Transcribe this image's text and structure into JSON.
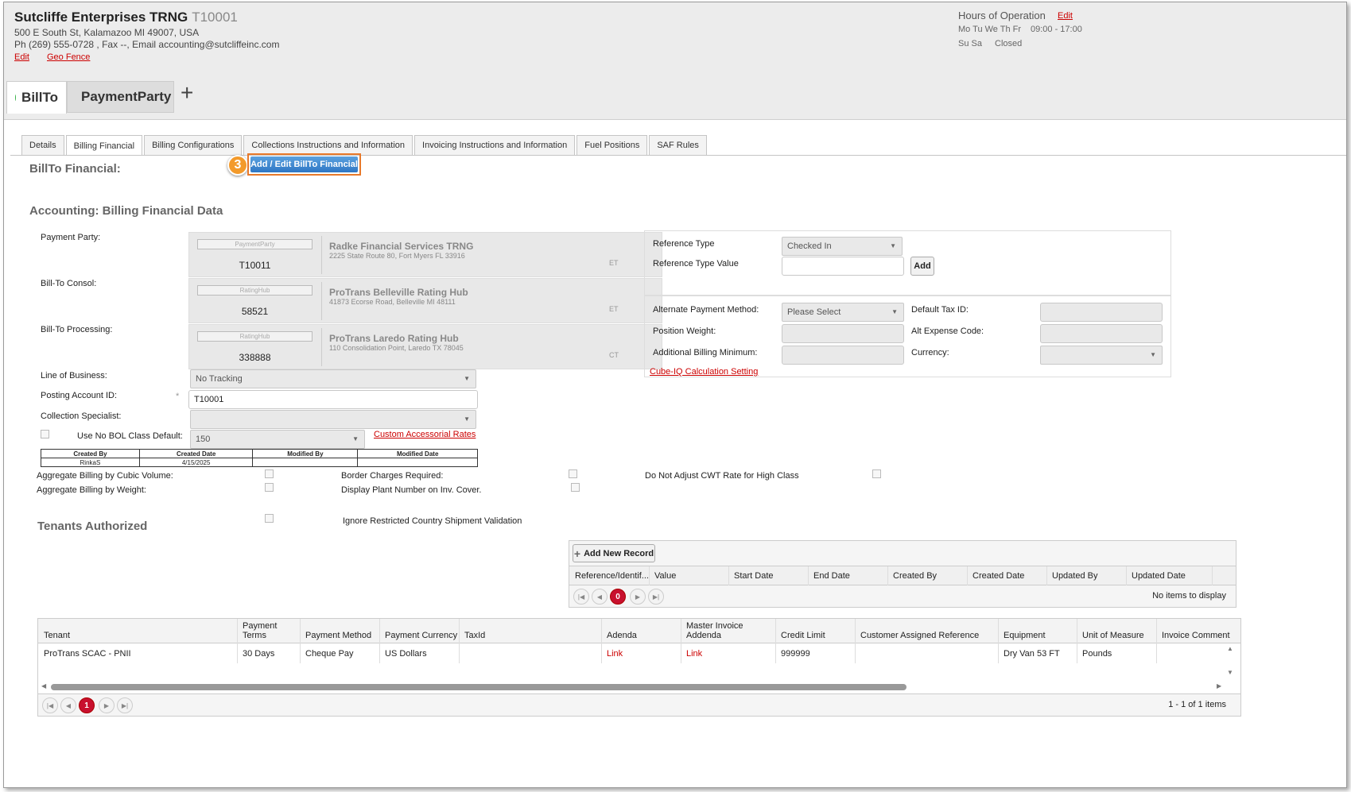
{
  "company": {
    "name": "Sutcliffe Enterprises TRNG",
    "id": "T10001",
    "address": "500 E South St, Kalamazoo MI 49007, USA",
    "contact": "Ph (269) 555-0728 , Fax --, Email accounting@sutcliffeinc.com",
    "edit": "Edit",
    "geo_fence": "Geo Fence"
  },
  "hours": {
    "title": "Hours of Operation",
    "edit": "Edit",
    "days1": "Mo Tu We Th Fr",
    "time1": "09:00 - 17:00",
    "days2": "Su Sa",
    "time2": "Closed"
  },
  "customer_tabs": [
    {
      "label": "BillTo",
      "color": "#3cb44b"
    },
    {
      "label": "PaymentParty",
      "color": "#aaaaaa"
    }
  ],
  "add_tab": "+",
  "subtabs": [
    "Details",
    "Billing Financial",
    "Billing Configurations",
    "Collections Instructions and Information",
    "Invoicing Instructions and Information",
    "Fuel Positions",
    "SAF Rules"
  ],
  "billto_financial": {
    "title": "BillTo Financial:",
    "step": "3",
    "button": "Add / Edit BillTo Financial"
  },
  "accounting": {
    "title": "Accounting: Billing Financial Data",
    "parties": [
      {
        "label": "Payment Party:",
        "tag": "PaymentParty",
        "id": "T10011",
        "name": "Radke Financial Services TRNG",
        "address": "2225 State Route 80, Fort Myers FL 33916",
        "tz": "ET"
      },
      {
        "label": "Bill-To Consol:",
        "tag": "RatingHub",
        "id": "58521",
        "name": "ProTrans Belleville Rating Hub",
        "address": "41873 Ecorse Road, Belleville MI 48111",
        "tz": "ET"
      },
      {
        "label": "Bill-To Processing:",
        "tag": "RatingHub",
        "id": "338888",
        "name": "ProTrans Laredo Rating Hub",
        "address": "110 Consolidation Point, Laredo TX 78045",
        "tz": "CT"
      }
    ],
    "line_of_business": {
      "label": "Line of Business:",
      "value": "No Tracking"
    },
    "posting_account": {
      "label": "Posting Account ID:",
      "required": "*",
      "value": "T10001"
    },
    "collection_specialist": {
      "label": "Collection Specialist:",
      "value": ""
    },
    "no_bol": {
      "label": "Use No BOL Class Default:",
      "value": "150"
    },
    "custom_accessorial": "Custom Accessorial Rates",
    "audit": {
      "headers": [
        "Created By",
        "Created Date",
        "Modified By",
        "Modified Date"
      ],
      "values": [
        "RinkaS",
        "4/15/2025",
        "",
        ""
      ]
    }
  },
  "reference": {
    "type_label": "Reference Type",
    "type_value": "Checked In",
    "value_label": "Reference Type Value",
    "value": "",
    "add": "Add"
  },
  "financial_fields": {
    "alt_payment": {
      "label": "Alternate Payment Method:",
      "value": "Please Select"
    },
    "default_tax": {
      "label": "Default Tax ID:",
      "value": ""
    },
    "position_weight": {
      "label": "Position Weight:",
      "value": ""
    },
    "alt_expense": {
      "label": "Alt Expense Code:",
      "value": ""
    },
    "additional_min": {
      "label": "Additional Billing Minimum:",
      "value": ""
    },
    "currency": {
      "label": "Currency:",
      "value": ""
    },
    "cube_iq": "Cube-IQ Calculation Setting"
  },
  "checkboxes": {
    "agg_cubic": "Aggregate Billing by Cubic Volume:",
    "agg_weight": "Aggregate Billing by Weight:",
    "border": "Border Charges Required:",
    "plant": "Display Plant Number on Inv. Cover.",
    "cwt": "Do Not Adjust CWT Rate for High Class",
    "restricted": "Ignore Restricted Country Shipment Validation"
  },
  "tenants_title": "Tenants Authorized",
  "ref_grid": {
    "add": "Add New Record",
    "columns": [
      "Reference/Identif...",
      "Value",
      "Start Date",
      "End Date",
      "Created By",
      "Created Date",
      "Updated By",
      "Updated Date"
    ],
    "page": "0",
    "empty": "No items to display"
  },
  "tenant_grid": {
    "columns": [
      "Tenant",
      "Payment Terms",
      "Payment Method",
      "Payment Currency",
      "TaxId",
      "Adenda",
      "Master Invoice Addenda",
      "Credit Limit",
      "Customer Assigned Reference",
      "Equipment",
      "Unit of Measure",
      "Invoice Comment"
    ],
    "row": [
      "ProTrans SCAC - PNII",
      "30 Days",
      "Cheque Pay",
      "US Dollars",
      "",
      "Link",
      "Link",
      "999999",
      "",
      "Dry Van 53 FT",
      "Pounds",
      ""
    ],
    "page": "1",
    "summary": "1 - 1 of 1 items"
  }
}
